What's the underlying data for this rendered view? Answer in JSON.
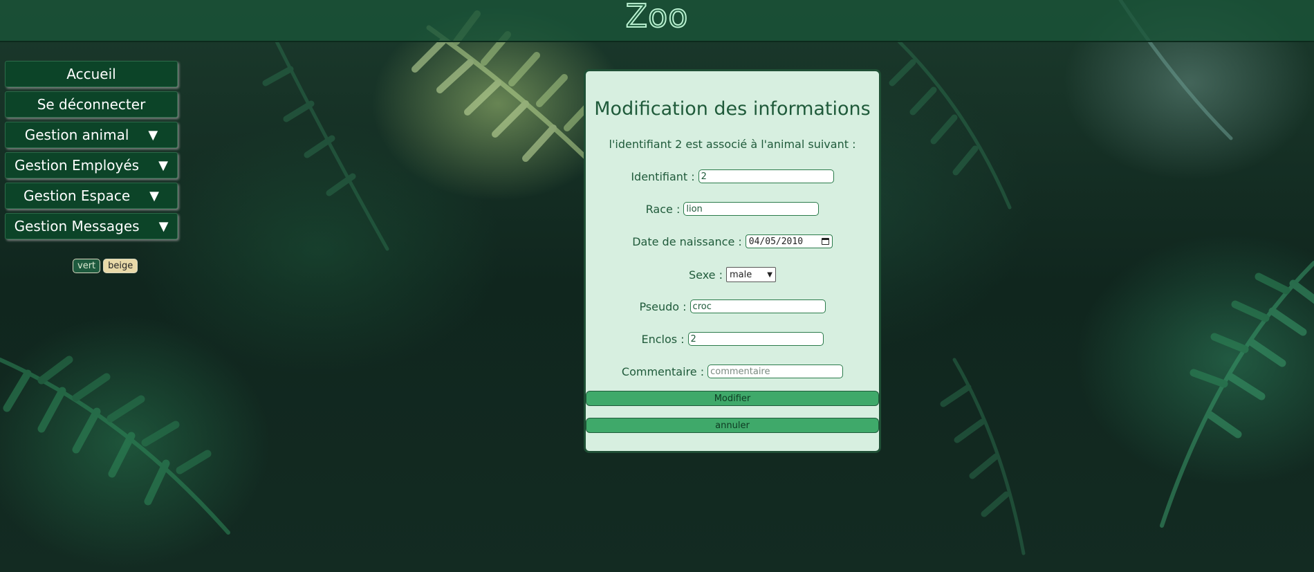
{
  "app": {
    "logo_text": "Zoo"
  },
  "sidebar": {
    "items": [
      {
        "label": "Accueil",
        "dropdown": false
      },
      {
        "label": "Se déconnecter",
        "dropdown": false
      },
      {
        "label": "Gestion animal",
        "dropdown": true
      },
      {
        "label": "Gestion Employés",
        "dropdown": true
      },
      {
        "label": "Gestion Espace",
        "dropdown": true
      },
      {
        "label": "Gestion Messages",
        "dropdown": true
      }
    ],
    "arrow_glyph": "▼"
  },
  "theme": {
    "vert_label": "vert",
    "beige_label": "beige"
  },
  "form": {
    "title": "Modification des informations",
    "subtitle": "l'identifiant 2 est associé à l'animal suivant :",
    "identifiant_label": "Identifiant :",
    "identifiant_value": "2",
    "race_label": "Race :",
    "race_value": "lion",
    "date_label": "Date de naissance :",
    "date_value": "04/05/2010",
    "sexe_label": "Sexe :",
    "sexe_value": "male",
    "pseudo_label": "Pseudo :",
    "pseudo_value": "croc",
    "enclos_label": "Enclos :",
    "enclos_value": "2",
    "commentaire_label": "Commentaire :",
    "commentaire_placeholder": "commentaire",
    "modifier_label": "Modifier",
    "annuler_label": "annuler"
  },
  "colors": {
    "accent": "#0c4428",
    "card_bg": "#d7efe0",
    "text_green": "#1f5a3a",
    "button_green": "#3fa96a"
  }
}
